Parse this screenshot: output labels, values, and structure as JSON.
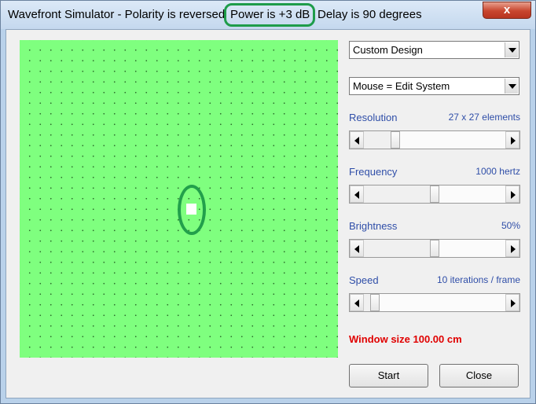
{
  "window": {
    "title": "Wavefront Simulator - Polarity is reversed",
    "title_power": "Power is +3 dB",
    "title_delay": "Delay is 90 degrees",
    "close_glyph": "x"
  },
  "design_dropdown": {
    "value": "Custom Design"
  },
  "mouse_dropdown": {
    "value": "Mouse = Edit System"
  },
  "sliders": [
    {
      "label": "Resolution",
      "value_text": "27 x 27 elements",
      "level": 0.2
    },
    {
      "label": "Frequency",
      "value_text": "1000 hertz",
      "level": 0.5
    },
    {
      "label": "Brightness",
      "value_text": "50%",
      "level": 0.5
    },
    {
      "label": "Speed",
      "value_text": "10 iterations / frame",
      "level": 0.05
    }
  ],
  "window_size": "Window size 100.00 cm",
  "buttons": {
    "start": "Start",
    "close": "Close"
  },
  "colors": {
    "canvas": "#7fff7f",
    "source": "#ffffff",
    "highlight": "#1e9c4a",
    "label_blue": "#2f4ea8",
    "window_size_red": "#e00000"
  }
}
